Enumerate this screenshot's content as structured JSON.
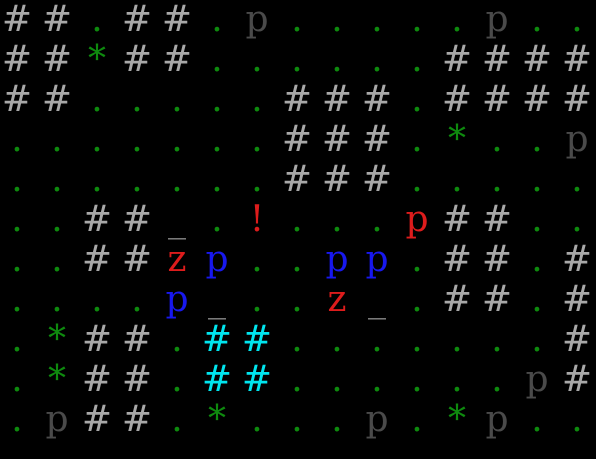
{
  "palette": {
    "wall": "#a8a8a8",
    "floor": "#0e8a0e",
    "tree": "#0e8a0e",
    "doorway": "#8a8a8a",
    "hostile": "#dd1c1c",
    "ally": "#1818ee",
    "neutral": "#4a4a4a",
    "water": "#00e5ee",
    "item": "#dd1c1c"
  },
  "legend": {
    "#": {
      "name": "wall",
      "color": "wall"
    },
    ".": {
      "name": "floor",
      "color": "floor"
    },
    "*": {
      "name": "tree",
      "color": "tree"
    },
    "_": {
      "name": "doorway",
      "color": "doorway"
    },
    "!": {
      "name": "potion",
      "color": "item"
    }
  },
  "rows": [
    [
      {
        "ch": "#",
        "c": "wall"
      },
      {
        "ch": "#",
        "c": "wall"
      },
      {
        "ch": ".",
        "c": "floor"
      },
      {
        "ch": "#",
        "c": "wall"
      },
      {
        "ch": "#",
        "c": "wall"
      },
      {
        "ch": ".",
        "c": "floor"
      },
      {
        "ch": "p",
        "c": "neutral"
      },
      {
        "ch": ".",
        "c": "floor"
      },
      {
        "ch": ".",
        "c": "floor"
      },
      {
        "ch": ".",
        "c": "floor"
      },
      {
        "ch": ".",
        "c": "floor"
      },
      {
        "ch": ".",
        "c": "floor"
      },
      {
        "ch": "p",
        "c": "neutral"
      },
      {
        "ch": ".",
        "c": "floor"
      },
      {
        "ch": ".",
        "c": "floor"
      }
    ],
    [
      {
        "ch": "#",
        "c": "wall"
      },
      {
        "ch": "#",
        "c": "wall"
      },
      {
        "ch": "*",
        "c": "tree"
      },
      {
        "ch": "#",
        "c": "wall"
      },
      {
        "ch": "#",
        "c": "wall"
      },
      {
        "ch": ".",
        "c": "floor"
      },
      {
        "ch": ".",
        "c": "floor"
      },
      {
        "ch": ".",
        "c": "floor"
      },
      {
        "ch": ".",
        "c": "floor"
      },
      {
        "ch": ".",
        "c": "floor"
      },
      {
        "ch": ".",
        "c": "floor"
      },
      {
        "ch": "#",
        "c": "wall"
      },
      {
        "ch": "#",
        "c": "wall"
      },
      {
        "ch": "#",
        "c": "wall"
      },
      {
        "ch": "#",
        "c": "wall"
      }
    ],
    [
      {
        "ch": "#",
        "c": "wall"
      },
      {
        "ch": "#",
        "c": "wall"
      },
      {
        "ch": ".",
        "c": "floor"
      },
      {
        "ch": ".",
        "c": "floor"
      },
      {
        "ch": ".",
        "c": "floor"
      },
      {
        "ch": ".",
        "c": "floor"
      },
      {
        "ch": ".",
        "c": "floor"
      },
      {
        "ch": "#",
        "c": "wall"
      },
      {
        "ch": "#",
        "c": "wall"
      },
      {
        "ch": "#",
        "c": "wall"
      },
      {
        "ch": ".",
        "c": "floor"
      },
      {
        "ch": "#",
        "c": "wall"
      },
      {
        "ch": "#",
        "c": "wall"
      },
      {
        "ch": "#",
        "c": "wall"
      },
      {
        "ch": "#",
        "c": "wall"
      }
    ],
    [
      {
        "ch": ".",
        "c": "floor"
      },
      {
        "ch": ".",
        "c": "floor"
      },
      {
        "ch": ".",
        "c": "floor"
      },
      {
        "ch": ".",
        "c": "floor"
      },
      {
        "ch": ".",
        "c": "floor"
      },
      {
        "ch": ".",
        "c": "floor"
      },
      {
        "ch": ".",
        "c": "floor"
      },
      {
        "ch": "#",
        "c": "wall"
      },
      {
        "ch": "#",
        "c": "wall"
      },
      {
        "ch": "#",
        "c": "wall"
      },
      {
        "ch": ".",
        "c": "floor"
      },
      {
        "ch": "*",
        "c": "tree"
      },
      {
        "ch": ".",
        "c": "floor"
      },
      {
        "ch": ".",
        "c": "floor"
      },
      {
        "ch": "p",
        "c": "neutral"
      }
    ],
    [
      {
        "ch": ".",
        "c": "floor"
      },
      {
        "ch": ".",
        "c": "floor"
      },
      {
        "ch": ".",
        "c": "floor"
      },
      {
        "ch": ".",
        "c": "floor"
      },
      {
        "ch": ".",
        "c": "floor"
      },
      {
        "ch": ".",
        "c": "floor"
      },
      {
        "ch": ".",
        "c": "floor"
      },
      {
        "ch": "#",
        "c": "wall"
      },
      {
        "ch": "#",
        "c": "wall"
      },
      {
        "ch": "#",
        "c": "wall"
      },
      {
        "ch": ".",
        "c": "floor"
      },
      {
        "ch": ".",
        "c": "floor"
      },
      {
        "ch": ".",
        "c": "floor"
      },
      {
        "ch": ".",
        "c": "floor"
      },
      {
        "ch": ".",
        "c": "floor"
      }
    ],
    [
      {
        "ch": ".",
        "c": "floor"
      },
      {
        "ch": ".",
        "c": "floor"
      },
      {
        "ch": "#",
        "c": "wall"
      },
      {
        "ch": "#",
        "c": "wall"
      },
      {
        "ch": "_",
        "c": "doorway"
      },
      {
        "ch": ".",
        "c": "floor"
      },
      {
        "ch": "!",
        "c": "item"
      },
      {
        "ch": ".",
        "c": "floor"
      },
      {
        "ch": ".",
        "c": "floor"
      },
      {
        "ch": ".",
        "c": "floor"
      },
      {
        "ch": "p",
        "c": "hostile"
      },
      {
        "ch": "#",
        "c": "wall"
      },
      {
        "ch": "#",
        "c": "wall"
      },
      {
        "ch": ".",
        "c": "floor"
      },
      {
        "ch": ".",
        "c": "floor"
      }
    ],
    [
      {
        "ch": ".",
        "c": "floor"
      },
      {
        "ch": ".",
        "c": "floor"
      },
      {
        "ch": "#",
        "c": "wall"
      },
      {
        "ch": "#",
        "c": "wall"
      },
      {
        "ch": "z",
        "c": "hostile"
      },
      {
        "ch": "p",
        "c": "ally"
      },
      {
        "ch": ".",
        "c": "floor"
      },
      {
        "ch": ".",
        "c": "floor"
      },
      {
        "ch": "p",
        "c": "ally"
      },
      {
        "ch": "p",
        "c": "ally"
      },
      {
        "ch": ".",
        "c": "floor"
      },
      {
        "ch": "#",
        "c": "wall"
      },
      {
        "ch": "#",
        "c": "wall"
      },
      {
        "ch": ".",
        "c": "floor"
      },
      {
        "ch": "#",
        "c": "wall"
      }
    ],
    [
      {
        "ch": ".",
        "c": "floor"
      },
      {
        "ch": ".",
        "c": "floor"
      },
      {
        "ch": ".",
        "c": "floor"
      },
      {
        "ch": ".",
        "c": "floor"
      },
      {
        "ch": "p",
        "c": "ally"
      },
      {
        "ch": "_",
        "c": "doorway"
      },
      {
        "ch": ".",
        "c": "floor"
      },
      {
        "ch": ".",
        "c": "floor"
      },
      {
        "ch": "z",
        "c": "hostile"
      },
      {
        "ch": "_",
        "c": "doorway"
      },
      {
        "ch": ".",
        "c": "floor"
      },
      {
        "ch": "#",
        "c": "wall"
      },
      {
        "ch": "#",
        "c": "wall"
      },
      {
        "ch": ".",
        "c": "floor"
      },
      {
        "ch": "#",
        "c": "wall"
      }
    ],
    [
      {
        "ch": ".",
        "c": "floor"
      },
      {
        "ch": "*",
        "c": "tree"
      },
      {
        "ch": "#",
        "c": "wall"
      },
      {
        "ch": "#",
        "c": "wall"
      },
      {
        "ch": ".",
        "c": "floor"
      },
      {
        "ch": "#",
        "c": "water"
      },
      {
        "ch": "#",
        "c": "water"
      },
      {
        "ch": ".",
        "c": "floor"
      },
      {
        "ch": ".",
        "c": "floor"
      },
      {
        "ch": ".",
        "c": "floor"
      },
      {
        "ch": ".",
        "c": "floor"
      },
      {
        "ch": ".",
        "c": "floor"
      },
      {
        "ch": ".",
        "c": "floor"
      },
      {
        "ch": ".",
        "c": "floor"
      },
      {
        "ch": "#",
        "c": "wall"
      }
    ],
    [
      {
        "ch": ".",
        "c": "floor"
      },
      {
        "ch": "*",
        "c": "tree"
      },
      {
        "ch": "#",
        "c": "wall"
      },
      {
        "ch": "#",
        "c": "wall"
      },
      {
        "ch": ".",
        "c": "floor"
      },
      {
        "ch": "#",
        "c": "water"
      },
      {
        "ch": "#",
        "c": "water"
      },
      {
        "ch": ".",
        "c": "floor"
      },
      {
        "ch": ".",
        "c": "floor"
      },
      {
        "ch": ".",
        "c": "floor"
      },
      {
        "ch": ".",
        "c": "floor"
      },
      {
        "ch": ".",
        "c": "floor"
      },
      {
        "ch": ".",
        "c": "floor"
      },
      {
        "ch": "p",
        "c": "neutral"
      },
      {
        "ch": "#",
        "c": "wall"
      }
    ],
    [
      {
        "ch": ".",
        "c": "floor"
      },
      {
        "ch": "p",
        "c": "neutral"
      },
      {
        "ch": "#",
        "c": "wall"
      },
      {
        "ch": "#",
        "c": "wall"
      },
      {
        "ch": ".",
        "c": "floor"
      },
      {
        "ch": "*",
        "c": "tree"
      },
      {
        "ch": ".",
        "c": "floor"
      },
      {
        "ch": ".",
        "c": "floor"
      },
      {
        "ch": ".",
        "c": "floor"
      },
      {
        "ch": "p",
        "c": "neutral"
      },
      {
        "ch": ".",
        "c": "floor"
      },
      {
        "ch": "*",
        "c": "tree"
      },
      {
        "ch": "p",
        "c": "neutral"
      },
      {
        "ch": ".",
        "c": "floor"
      },
      {
        "ch": ".",
        "c": "floor"
      }
    ]
  ]
}
